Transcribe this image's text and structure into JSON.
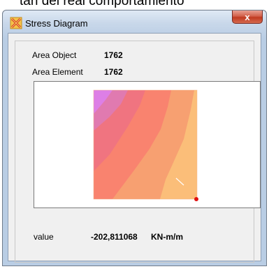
{
  "background": {
    "text": "tan del real comportamiento"
  },
  "window": {
    "title": "Stress Diagram",
    "close_label": "x"
  },
  "info": {
    "area_object_label": "Area Object",
    "area_object_value": "1762",
    "area_element_label": "Area Element",
    "area_element_value": "1762"
  },
  "result": {
    "value_label": "value",
    "value_number": "-202,811068",
    "value_units": "KN-m/m"
  },
  "colors": {
    "band_1": "#dd7fe6",
    "band_2": "#e07ab0",
    "band_3": "#f07480",
    "band_4": "#f9836f",
    "band_5": "#f7a071",
    "band_6": "#fbbe79",
    "marker": "#e01010"
  }
}
